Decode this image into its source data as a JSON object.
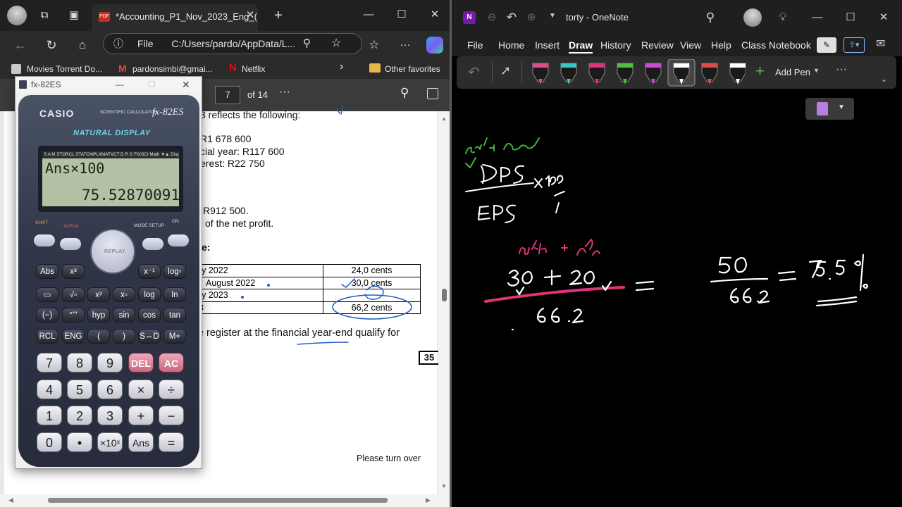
{
  "edge": {
    "tab_title": "*Accounting_P1_Nov_2023_Eng_(",
    "tab_icon": "pdf-icon",
    "address": "C:/Users/pardo/AppData/L...",
    "address_scheme": "File",
    "favorites": [
      "Movies Torrent Do...",
      "pardonsimbi@gmai...",
      "Netflix",
      "Other favorites"
    ],
    "pdf": {
      "page_number": "7",
      "page_total": "of 14",
      "lines": [
        "3 reflects the following:",
        "R1 678 600",
        "cial year: R117 600",
        "erest: R22 750",
        "R912 500.",
        "of the net profit.",
        "e:"
      ],
      "table": [
        [
          "ary 2022",
          "24,0 cents"
        ],
        [
          "August 2022",
          "30,0 cents"
        ],
        [
          "ary 2023",
          ""
        ],
        [
          "23",
          "66,2 cents"
        ]
      ],
      "register_line": "are register at the financial year-end qualify for",
      "marks_box": "35",
      "footer": "Please turn over"
    }
  },
  "calculator": {
    "window_title": "fx-82ES",
    "brand": "CASIO",
    "subtitle": "SCIENTIFIC CALCULATOR",
    "model": "fx-82ES",
    "natural_display": "NATURAL DISPLAY",
    "indicators": "S A M STORCL STATCMPLXMATVCT D R G FIXSCI Math ▼▲ Disp",
    "expression": "Ans×100",
    "result": "75.52870091",
    "func_keys": [
      "SHIFT",
      "ALPHA",
      "MODE SETUP",
      "ON"
    ],
    "replay": "REPLAY",
    "sci_keys": [
      [
        "Abs",
        "x³",
        "x⁻¹",
        "log▫"
      ],
      [
        "▭",
        "√▫",
        "x²",
        "x▫",
        "log",
        "ln"
      ],
      [
        "(−)",
        "°'''",
        "hyp",
        "sin",
        "cos",
        "tan"
      ],
      [
        "RCL",
        "ENG",
        "(",
        ")",
        "S⇔D",
        "M+"
      ]
    ],
    "num_keys": [
      [
        "7",
        "8",
        "9",
        "DEL",
        "AC"
      ],
      [
        "4",
        "5",
        "6",
        "×",
        "÷"
      ],
      [
        "1",
        "2",
        "3",
        "+",
        "−"
      ],
      [
        "0",
        "•",
        "×10ˣ",
        "Ans",
        "="
      ]
    ]
  },
  "onenote": {
    "title": "torty - OneNote",
    "menu": [
      "File",
      "Home",
      "Insert",
      "Draw",
      "History",
      "Review",
      "View",
      "Help",
      "Class Notebook"
    ],
    "active_menu": "Draw",
    "add_pen": "Add Pen",
    "pen_colors": [
      "#e24a8c",
      "#35c9c9",
      "#e0337a",
      "#4cc23a",
      "#c94ad9",
      "#ffffff",
      "#e24a4a",
      "#ffffff"
    ]
  }
}
